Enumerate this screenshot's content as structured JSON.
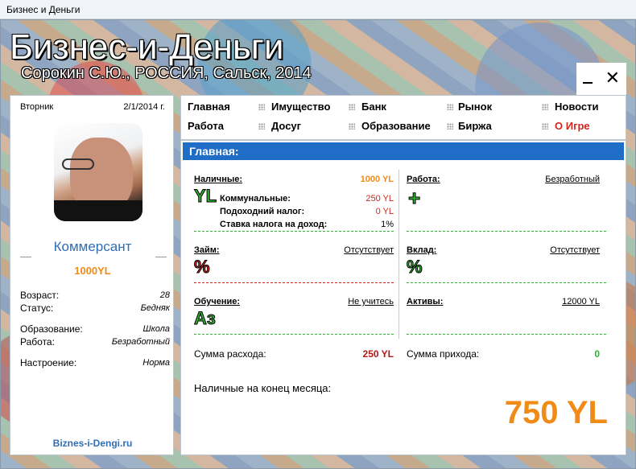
{
  "window": {
    "title": "Бизнес и Деньги"
  },
  "header": {
    "title": "Бизнес-и-Деньги",
    "subtitle": "Сорокин С.Ю., РОССИЯ, Сальск, 2014",
    "close_glyph": "✕"
  },
  "profile": {
    "weekday": "Вторник",
    "date": "2/1/2014 г.",
    "rank": "Коммерсант",
    "money": "1000YL",
    "stats": [
      {
        "label": "Возраст:",
        "value": "28"
      },
      {
        "label": "Статус:",
        "value": "Бедняк"
      },
      {
        "label": "Образование:",
        "value": "Школа"
      },
      {
        "label": "Работа:",
        "value": "Безработный"
      },
      {
        "label": "Настроение:",
        "value": "Норма"
      }
    ],
    "site": "Biznes-i-Dengi.ru"
  },
  "nav": {
    "items": [
      "Главная",
      "Имущество",
      "Банк",
      "Рынок",
      "Новости",
      "Работа",
      "Досуг",
      "Образование",
      "Биржа",
      "О Игре"
    ]
  },
  "main": {
    "section_title": "Главная:",
    "cash": {
      "label": "Наличные:",
      "value": "1000 YL",
      "icon_text": "YL",
      "rows": [
        {
          "label": "Коммунальные:",
          "value": "250 YL"
        },
        {
          "label": "Подоходний налог:",
          "value": "0 YL"
        },
        {
          "label": "Ставка налога на доход:",
          "value": "1%"
        }
      ]
    },
    "work": {
      "label": "Работа:",
      "value": "Безработный",
      "icon_text": "+"
    },
    "loan": {
      "label": "Займ:",
      "value": "Отсутствует",
      "icon_text": "%"
    },
    "deposit": {
      "label": "Вклад:",
      "value": "Отсутствует",
      "icon_text": "%"
    },
    "education": {
      "label": "Обучение:",
      "value": "Не учитесь",
      "icon_text": "Аз"
    },
    "assets": {
      "label": "Активы:",
      "value": "12000 YL"
    },
    "expense": {
      "label": "Сумма расхода:",
      "value": "250 YL"
    },
    "income": {
      "label": "Сумма прихода:",
      "value": "0"
    },
    "end_month": {
      "label": "Наличные на конец месяца:",
      "value": "750 YL"
    }
  },
  "colors": {
    "accent_blue": "#1f6dc7",
    "orange": "#f08b18",
    "red": "#d6241f",
    "green": "#2db52d"
  }
}
